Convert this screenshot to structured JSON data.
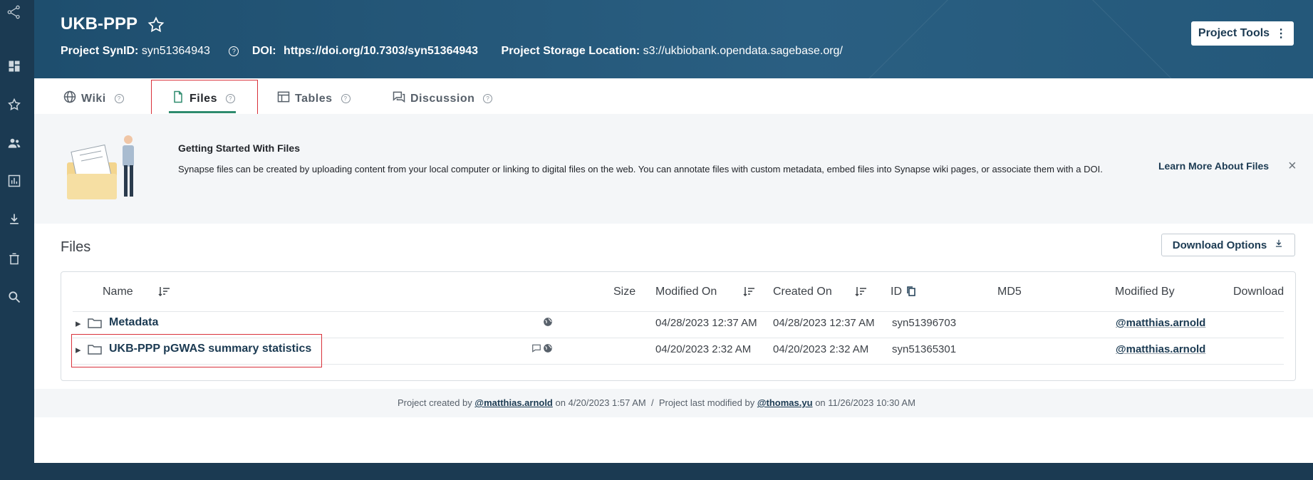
{
  "sidebar": {
    "icons": [
      "network-logo-icon",
      "dashboard-icon",
      "favorites-icon",
      "teams-icon",
      "projects-icon",
      "downloads-icon",
      "trash-icon",
      "search-icon"
    ]
  },
  "header": {
    "title": "UKB-PPP",
    "synid_label": "Project SynID:",
    "synid": "syn51364943",
    "doi_label": "DOI:",
    "doi": "https://doi.org/10.7303/syn51364943",
    "storage_label": "Project Storage Location:",
    "storage": "s3://ukbiobank.opendata.sagebase.org/",
    "tools_button": "Project Tools",
    "help_glyph": "?"
  },
  "tabs": [
    {
      "label": "Wiki"
    },
    {
      "label": "Files"
    },
    {
      "label": "Tables"
    },
    {
      "label": "Discussion"
    }
  ],
  "banner": {
    "title": "Getting Started With Files",
    "text": "Synapse files can be created by uploading content from your local computer or linking to digital files on the web. You can annotate files with custom metadata, embed files into Synapse wiki pages, or associate them with a DOI.",
    "learn_more": "Learn More About Files",
    "close": "×"
  },
  "files": {
    "heading": "Files",
    "download_options": "Download Options",
    "columns": [
      "Name",
      "Size",
      "Modified On",
      "Created On",
      "ID",
      "MD5",
      "Modified By",
      "Download"
    ],
    "rows": [
      {
        "name": "Metadata",
        "size": "",
        "modified_on": "04/28/2023 12:37 AM",
        "created_on": "04/28/2023 12:37 AM",
        "id": "syn51396703",
        "md5": "",
        "modified_by": "@matthias.arnold"
      },
      {
        "name": "UKB-PPP pGWAS summary statistics",
        "size": "",
        "modified_on": "04/20/2023 2:32 AM",
        "created_on": "04/20/2023 2:32 AM",
        "id": "syn51365301",
        "md5": "",
        "modified_by": "@matthias.arnold"
      }
    ]
  },
  "footer": {
    "created_prefix": "Project created by",
    "created_by": "@matthias.arnold",
    "created_on": "on 4/20/2023 1:57 AM",
    "separator": "/",
    "modified_prefix": "Project last modified by",
    "modified_by": "@thomas.yu",
    "modified_on": "on 11/26/2023 10:30 AM"
  },
  "colors": {
    "brand": "#1b3a52",
    "accent": "#2e8b6e",
    "highlight": "#d9313a"
  }
}
